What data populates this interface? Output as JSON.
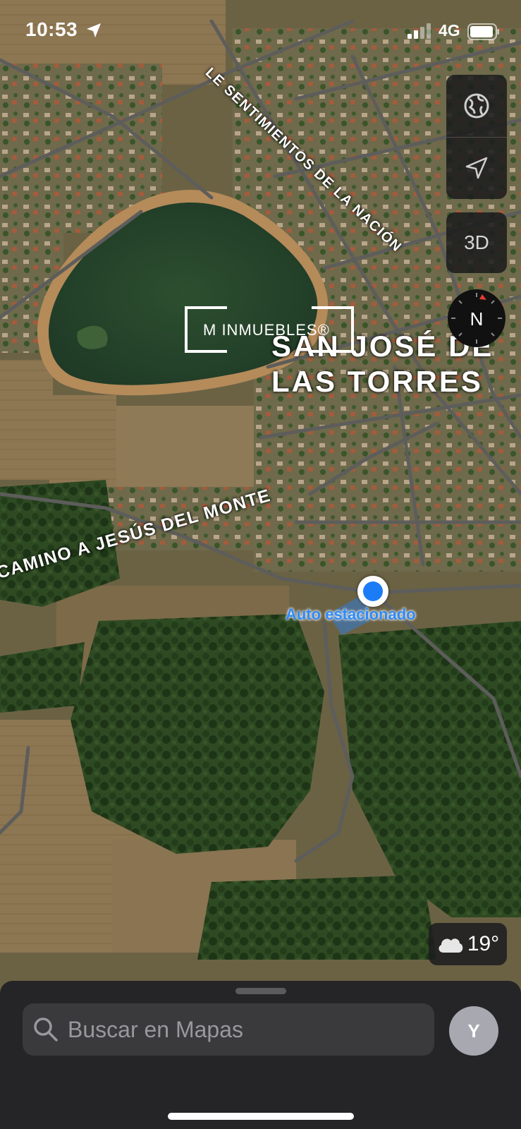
{
  "status_bar": {
    "time": "10:53",
    "network": "4G"
  },
  "map": {
    "town_label_line1": "SAN JOSÉ DE",
    "town_label_line2": "LAS TORRES",
    "road_label_1": "LE SENTIMIENTOS DE LA NACIÓN",
    "road_label_2": "CAMINO A JESÚS DEL MONTE",
    "parked_car_label": "Auto estacionado",
    "watermark_text": "M INMUEBLES®"
  },
  "controls": {
    "map_mode_icon": "globe-icon",
    "location_icon": "location-arrow-icon",
    "view_3d_label": "3D",
    "compass_label": "N"
  },
  "weather": {
    "icon": "cloud-icon",
    "temperature": "19°"
  },
  "search": {
    "placeholder": "Buscar en Mapas"
  },
  "account": {
    "initial": "Y"
  },
  "colors": {
    "accent": "#1c7cf5",
    "sheet": "#252527",
    "search_field": "#3a3a3c"
  }
}
